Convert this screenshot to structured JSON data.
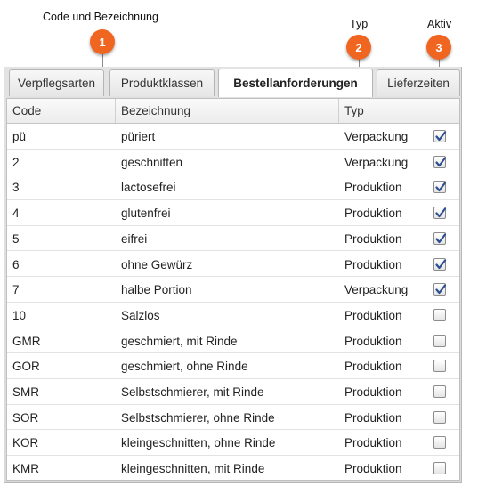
{
  "callouts": [
    {
      "label": "Code und Bezeichnung",
      "number": "1"
    },
    {
      "label": "Typ",
      "number": "2"
    },
    {
      "label": "Aktiv",
      "number": "3"
    }
  ],
  "tabs": [
    "Verpflegsarten",
    "Produktklassen",
    "Bestellanforderungen",
    "Lieferzeiten"
  ],
  "active_tab": "Bestellanforderungen",
  "columns": {
    "code": "Code",
    "bezeichnung": "Bezeichnung",
    "typ": "Typ",
    "aktiv": ""
  },
  "rows": [
    {
      "code": "pü",
      "bezeichnung": "püriert",
      "typ": "Verpackung",
      "aktiv": true
    },
    {
      "code": "2",
      "bezeichnung": "geschnitten",
      "typ": "Verpackung",
      "aktiv": true
    },
    {
      "code": "3",
      "bezeichnung": "lactosefrei",
      "typ": "Produktion",
      "aktiv": true
    },
    {
      "code": "4",
      "bezeichnung": "glutenfrei",
      "typ": "Produktion",
      "aktiv": true
    },
    {
      "code": "5",
      "bezeichnung": "eifrei",
      "typ": "Produktion",
      "aktiv": true
    },
    {
      "code": "6",
      "bezeichnung": "ohne Gewürz",
      "typ": "Produktion",
      "aktiv": true
    },
    {
      "code": "7",
      "bezeichnung": "halbe Portion",
      "typ": "Verpackung",
      "aktiv": true
    },
    {
      "code": "10",
      "bezeichnung": "Salzlos",
      "typ": "Produktion",
      "aktiv": false
    },
    {
      "code": "GMR",
      "bezeichnung": "geschmiert, mit Rinde",
      "typ": "Produktion",
      "aktiv": false
    },
    {
      "code": "GOR",
      "bezeichnung": "geschmiert, ohne Rinde",
      "typ": "Produktion",
      "aktiv": false
    },
    {
      "code": "SMR",
      "bezeichnung": "Selbstschmierer, mit Rinde",
      "typ": "Produktion",
      "aktiv": false
    },
    {
      "code": "SOR",
      "bezeichnung": "Selbstschmierer, ohne Rinde",
      "typ": "Produktion",
      "aktiv": false
    },
    {
      "code": "KOR",
      "bezeichnung": "kleingeschnitten, ohne Rinde",
      "typ": "Produktion",
      "aktiv": false
    },
    {
      "code": "KMR",
      "bezeichnung": "kleingeschnitten, mit Rinde",
      "typ": "Produktion",
      "aktiv": false
    }
  ],
  "colors": {
    "badge": "#f0651f",
    "check": "#2d4f8f"
  }
}
